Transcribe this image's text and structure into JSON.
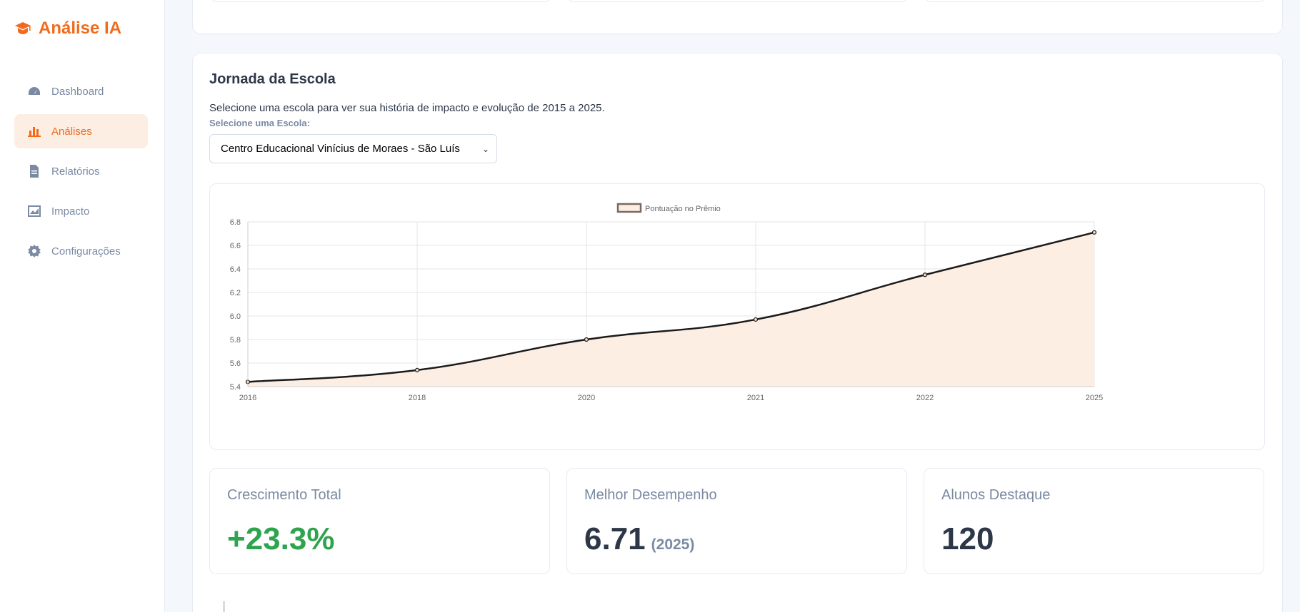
{
  "brand": {
    "name": "Análise IA",
    "icon": "graduation-cap-icon",
    "color": "#f26b1d"
  },
  "sidebar": {
    "items": [
      {
        "label": "Dashboard",
        "icon": "gauge-icon",
        "active": false
      },
      {
        "label": "Análises",
        "icon": "bar-chart-icon",
        "active": true
      },
      {
        "label": "Relatórios",
        "icon": "document-icon",
        "active": false
      },
      {
        "label": "Impacto",
        "icon": "image-chart-icon",
        "active": false
      },
      {
        "label": "Configurações",
        "icon": "gear-icon",
        "active": false
      }
    ]
  },
  "journey": {
    "title": "Jornada da Escola",
    "description": "Selecione uma escola para ver sua história de impacto e evolução de 2015 a 2025.",
    "select_label": "Selecione uma Escola:",
    "selected_school": "Centro Educacional Vinícius de Moraes - São Luís"
  },
  "chart_data": {
    "type": "area",
    "x": [
      "2016",
      "2018",
      "2020",
      "2021",
      "2022",
      "2025"
    ],
    "series": [
      {
        "name": "Pontuação no Prêmio",
        "values": [
          5.44,
          5.54,
          5.8,
          5.97,
          6.35,
          6.71
        ]
      }
    ],
    "ylim": [
      5.4,
      6.8
    ],
    "yticks": [
      "5.4",
      "5.6",
      "5.8",
      "6.0",
      "6.2",
      "6.4",
      "6.6",
      "6.8"
    ],
    "legend": "top",
    "grid": true,
    "line_color": "#1a1a1a",
    "fill_color": "#fdeee3"
  },
  "stats": {
    "growth": {
      "title": "Crescimento Total",
      "value": "+23.3%",
      "color": "#2fa44f"
    },
    "best": {
      "title": "Melhor Desempenho",
      "value": "6.71",
      "year": "(2025)"
    },
    "students": {
      "title": "Alunos Destaque",
      "value": "120"
    }
  }
}
